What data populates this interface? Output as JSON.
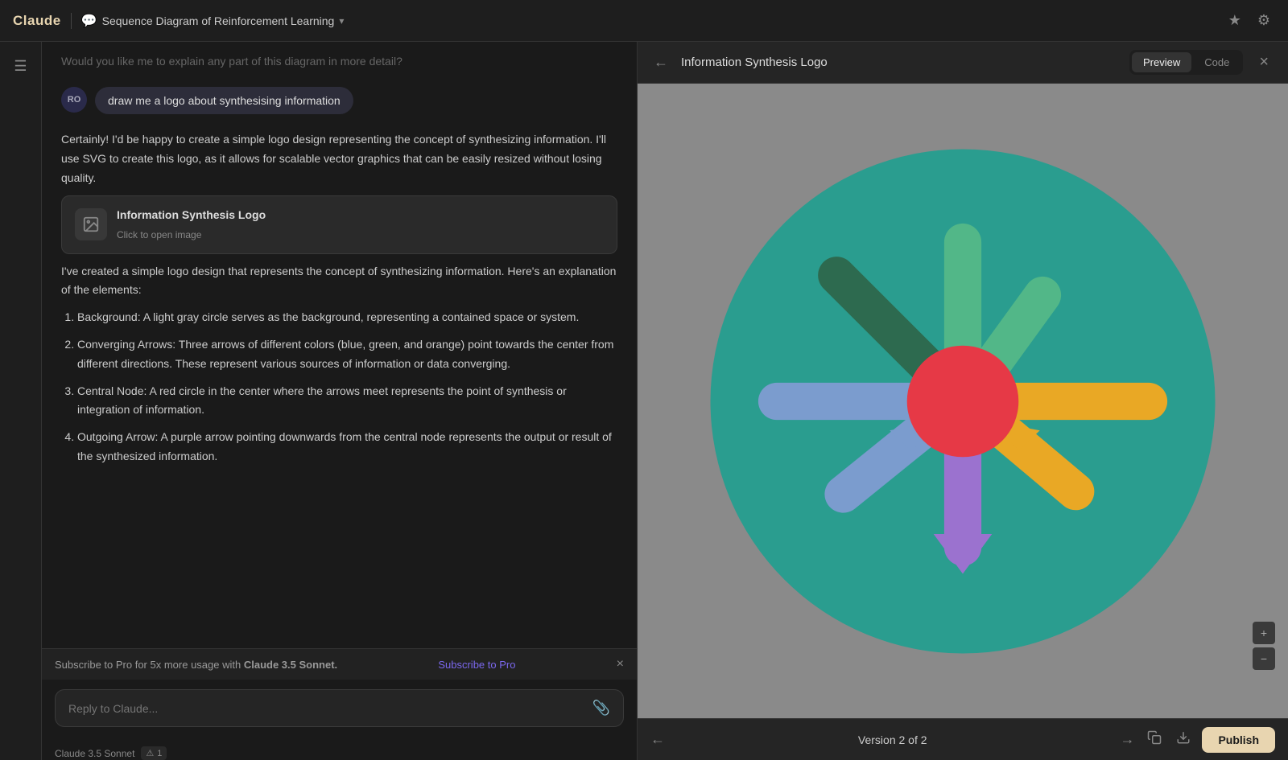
{
  "app": {
    "name": "Claude",
    "title": "Sequence Diagram of Reinforcement Learning",
    "title_icon": "chat-bubble-icon",
    "chevron": "▾"
  },
  "topbar": {
    "star_label": "★",
    "settings_label": "⚙"
  },
  "sidebar": {
    "toggle_icon": "☰"
  },
  "chat": {
    "faded_msg": "Would you like me to explain any part of this diagram in more detail?",
    "user_avatar": "RO",
    "user_msg": "draw me a logo about synthesising information",
    "ai_intro": "Certainly! I'd be happy to create a simple logo design representing the concept of synthesizing information. I'll use SVG to create this logo, as it allows for scalable vector graphics that can be easily resized without losing quality.",
    "image_card": {
      "title": "Information Synthesis Logo",
      "subtitle": "Click to open image",
      "icon": "🖼"
    },
    "ai_body": "I've created a simple logo design that represents the concept of synthesizing information. Here's an explanation of the elements:",
    "list_items": [
      {
        "num": "1.",
        "text": "Background: A light gray circle serves as the background, representing a contained space or system."
      },
      {
        "num": "2.",
        "text": "Converging Arrows: Three arrows of different colors (blue, green, and orange) point towards the center from different directions. These represent various sources of information or data converging."
      },
      {
        "num": "3.",
        "text": "Central Node: A red circle in the center where the arrows meet represents the point of synthesis or integration of information."
      },
      {
        "num": "4.",
        "text": "Outgoing Arrow: A purple arrow pointing downwards from the central node represents the output or result of the synthesized information."
      }
    ]
  },
  "subscribe_banner": {
    "text": "Subscribe to Pro for 5x more usage with ",
    "highlight": "Claude 3.5 Sonnet.",
    "link": "Subscribe to Pro",
    "close": "×"
  },
  "input": {
    "placeholder": "Reply to Claude...",
    "attach_icon": "📎"
  },
  "model_info": {
    "name": "Claude 3.5 Sonnet",
    "warning_icon": "⚠",
    "warning_count": "1"
  },
  "preview": {
    "back_icon": "←",
    "title": "Information Synthesis Logo",
    "tab_preview": "Preview",
    "tab_code": "Code",
    "close_icon": "×",
    "zoom_in": "+",
    "zoom_out": "−",
    "version_text": "Version 2 of 2",
    "prev_icon": "←",
    "next_icon": "→",
    "copy_icon": "⧉",
    "download_icon": "↓",
    "publish_label": "Publish"
  },
  "logo": {
    "bg_color": "#2a9d8f",
    "circle_bg": "#2a9d8f",
    "center_color": "#e63946",
    "arrow_green_dark": "#2d6a4f",
    "arrow_green_light": "#52b788",
    "arrow_blue": "#7b9cce",
    "arrow_orange": "#e9c46a",
    "arrow_purple": "#9b72cf"
  }
}
